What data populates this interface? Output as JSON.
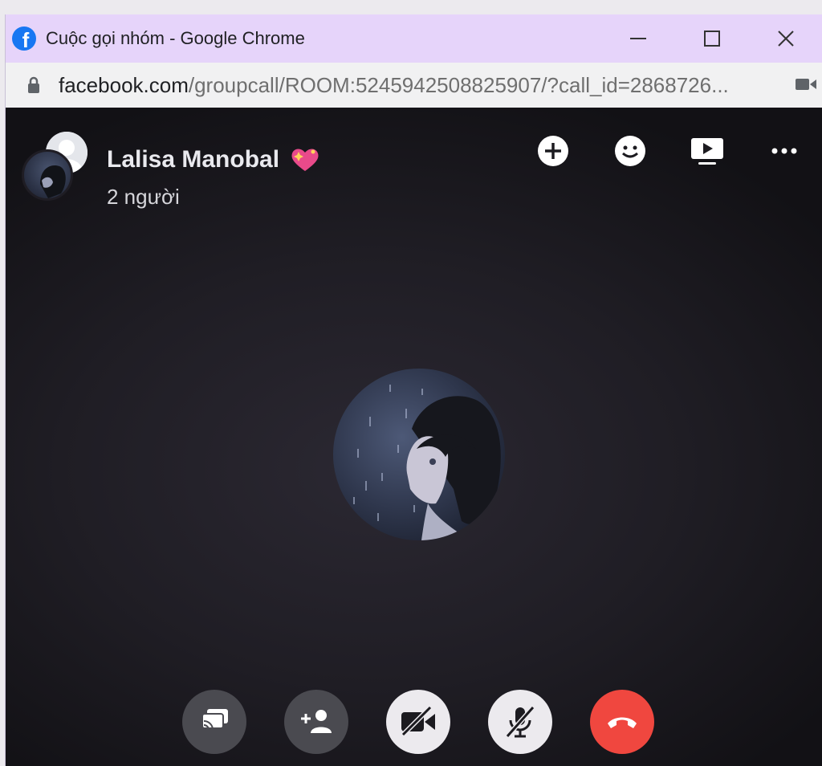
{
  "window": {
    "title": "Cuộc gọi nhóm - Google Chrome",
    "url_domain": "facebook.com",
    "url_rest": "/groupcall/ROOM:5245942508825907/?call_id=2868726...",
    "icons": [
      "facebook-logo-icon",
      "minimize-icon",
      "maximize-icon",
      "close-icon",
      "lock-icon",
      "camera-icon"
    ]
  },
  "call": {
    "caller_name": "Lalisa Manobal",
    "participants": "2 người",
    "top_actions": [
      "add-icon",
      "emoji-icon",
      "share-screen-icon",
      "more-icon"
    ],
    "controls": [
      "share-screen-button",
      "add-person-button",
      "camera-off-button",
      "mic-off-button",
      "end-call-button"
    ]
  },
  "colors": {
    "titlebar": "#e6d4fa",
    "end_call": "#f0473f",
    "facebook_blue": "#1877f2"
  }
}
